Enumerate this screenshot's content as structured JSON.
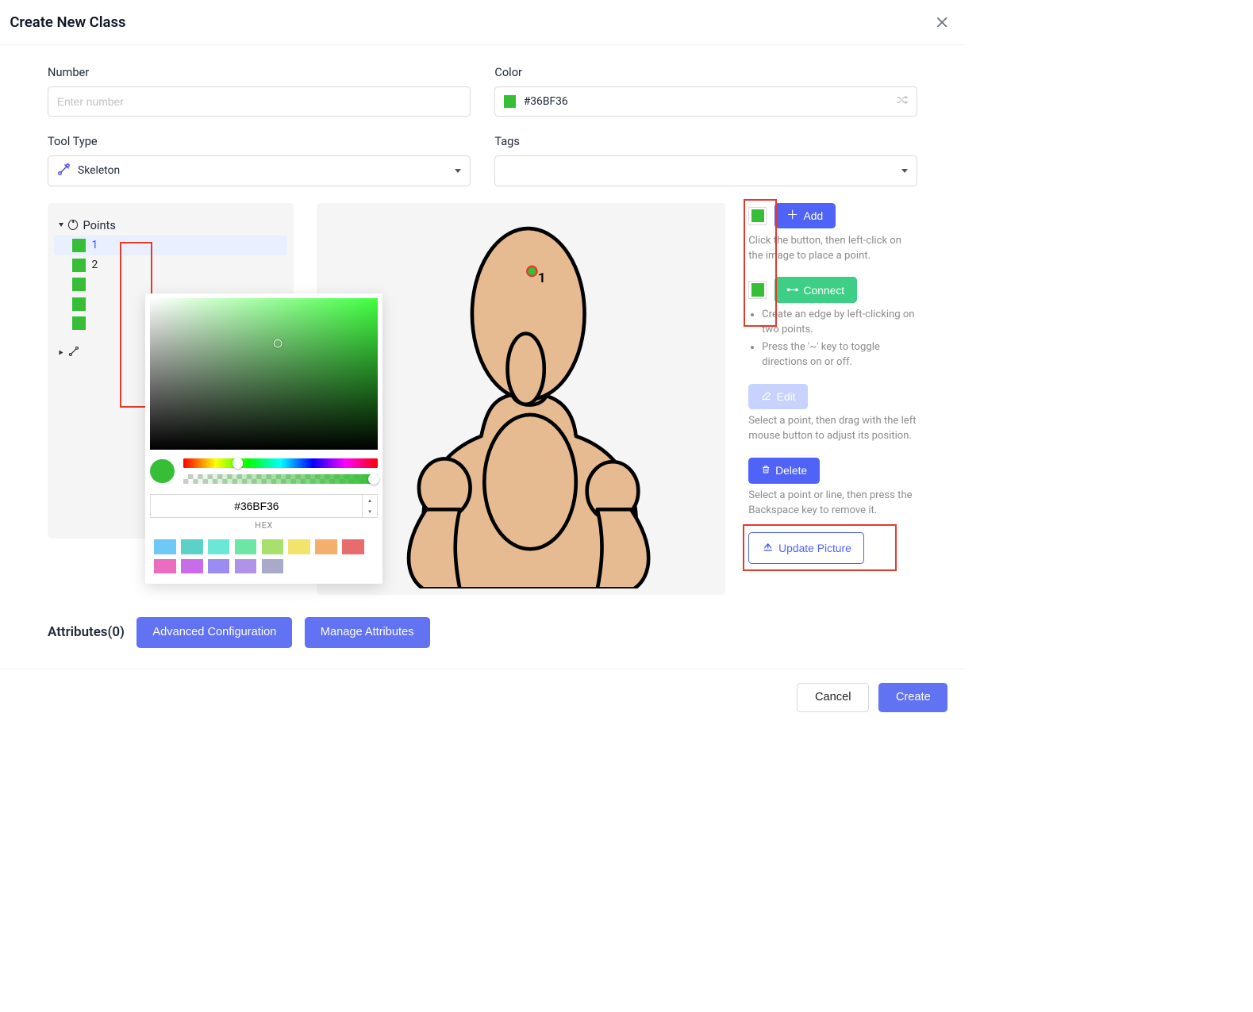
{
  "header": {
    "title": "Create New Class"
  },
  "fields": {
    "number": {
      "label": "Number",
      "placeholder": "Enter number",
      "value": ""
    },
    "color": {
      "label": "Color",
      "value": "#36BF36"
    },
    "toolType": {
      "label": "Tool Type",
      "value": "Skeleton"
    },
    "tags": {
      "label": "Tags",
      "value": ""
    }
  },
  "tree": {
    "pointsHeader": "Points",
    "points": [
      {
        "label": "1",
        "color": "#36BF36",
        "selected": true
      },
      {
        "label": "2",
        "color": "#36BF36"
      },
      {
        "label": "",
        "color": "#36BF36"
      },
      {
        "label": "",
        "color": "#36BF36"
      },
      {
        "label": "",
        "color": "#36BF36"
      }
    ]
  },
  "preview": {
    "pointLabel": "1"
  },
  "rightPanel": {
    "add": {
      "label": "Add",
      "hint": "Click the button, then left-click on the image to place a point."
    },
    "connect": {
      "label": "Connect",
      "bullets": [
        "Create an edge by left-clicking on two points.",
        "Press the '~' key to toggle directions on or off."
      ]
    },
    "edit": {
      "label": "Edit",
      "hint": "Select a point, then drag with the left mouse button to adjust its position."
    },
    "delete": {
      "label": "Delete",
      "hint": "Select a point or line, then press the Backspace key to remove it."
    },
    "updatePicture": {
      "label": "Update Picture"
    }
  },
  "colorPicker": {
    "hex": "#36BF36",
    "hexLabel": "HEX",
    "presets": [
      "#6ec9f7",
      "#5ad2c8",
      "#6be7d5",
      "#6ce6a5",
      "#a7e06c",
      "#f2e36c",
      "#f3b06c",
      "#e86c6c",
      "#ec6cc0",
      "#c96ceb",
      "#9a8cf3",
      "#b093e8",
      "#a9a9c9"
    ]
  },
  "attributes": {
    "title": "Attributes(0)",
    "advanced": "Advanced Configuration",
    "manage": "Manage Attributes"
  },
  "footer": {
    "cancel": "Cancel",
    "create": "Create"
  }
}
